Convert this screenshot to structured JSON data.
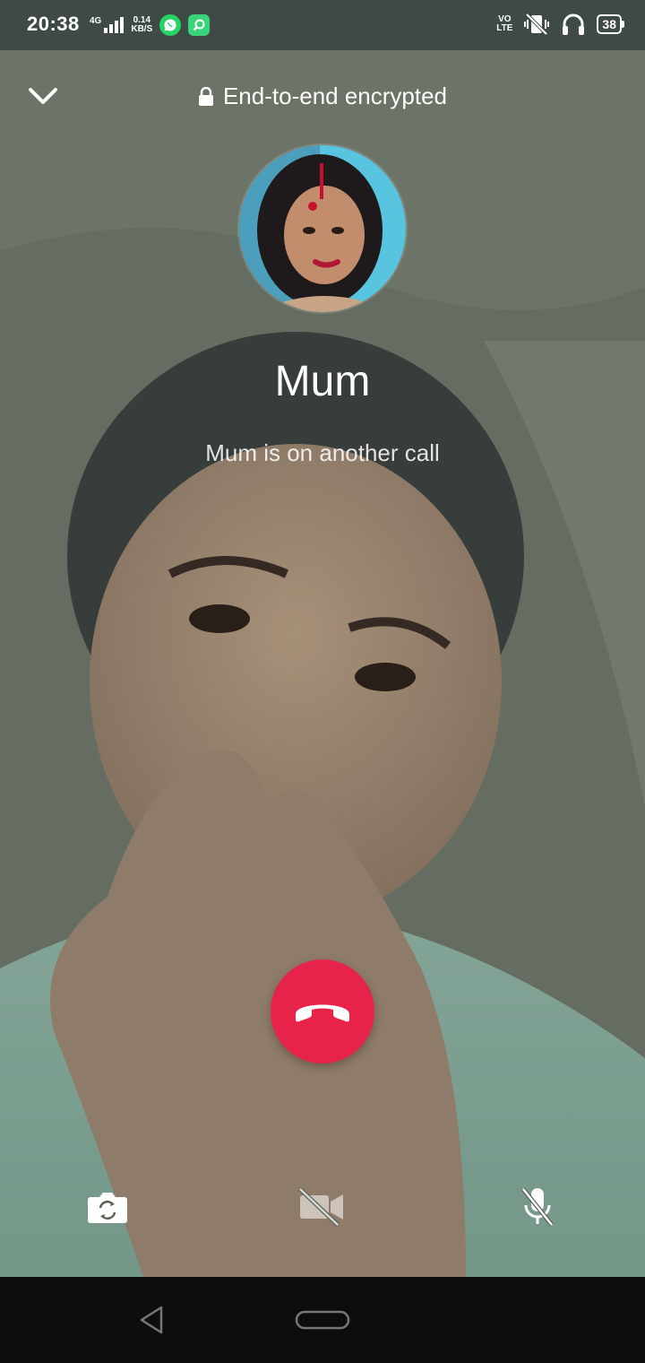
{
  "status_bar": {
    "time": "20:38",
    "network_type": "4G",
    "data_speed_value": "0.14",
    "data_speed_unit": "KB/S",
    "volte_top": "VO",
    "volte_bottom": "LTE",
    "battery": "38",
    "icons": [
      "signal-icon",
      "whatsapp-icon",
      "app-icon",
      "volte-icon",
      "vibrate-mute-icon",
      "headphones-icon",
      "battery-icon"
    ]
  },
  "call": {
    "encryption_label": "End-to-end encrypted",
    "contact_name": "Mum",
    "status_text": "Mum is on another call"
  },
  "controls": {
    "icons": [
      "switch-camera-icon",
      "video-off-icon",
      "mic-off-icon"
    ]
  },
  "colors": {
    "end_call": "#e8234a",
    "status_bar": "#3f4a46",
    "nav_bar": "#0d0d0d"
  }
}
